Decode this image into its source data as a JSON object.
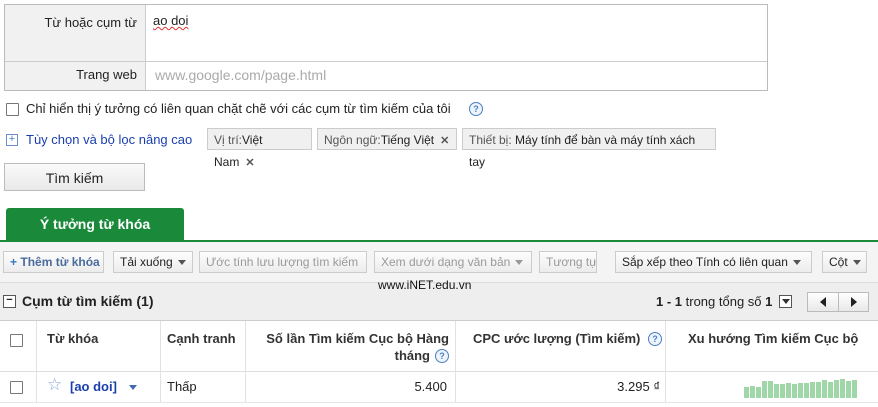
{
  "form": {
    "keyword_label": "Từ hoặc cụm từ",
    "keyword_value": "ao doi",
    "website_label": "Trang web",
    "website_placeholder": "www.google.com/page.html"
  },
  "options": {
    "close_match_label": "Chỉ hiển thị ý tưởng có liên quan chặt chẽ với các cụm từ tìm kiếm của tôi",
    "advanced_label": "Tùy chọn và bộ lọc nâng cao",
    "filters": [
      {
        "prefix": "Vị trí:",
        "value": "Việt Nam"
      },
      {
        "prefix": "Ngôn ngữ:",
        "value": "Tiếng Việt"
      },
      {
        "prefix": "Thiết bị: ",
        "value": "Máy tính để bàn và máy tính xách tay"
      }
    ]
  },
  "search_button": "Tìm kiếm",
  "tab": {
    "label": "Ý tưởng từ khóa"
  },
  "toolbar": {
    "add_keyword": "Thêm từ khóa",
    "download": "Tải xuống",
    "estimate_traffic": "Ước tính lưu lượng tìm kiếm",
    "view_as_text": "Xem dưới dạng văn bản",
    "similar": "Tương tự",
    "sort": "Sắp xếp theo Tính có liên quan",
    "columns": "Cột"
  },
  "watermark": "www.iNET.edu.vn",
  "group": {
    "title": "Cụm từ tìm kiếm (1)",
    "range": "1 - 1",
    "of_label": "trong tổng số",
    "total": "1"
  },
  "table": {
    "headers": {
      "keyword": "Từ khóa",
      "competition": "Cạnh tranh",
      "local_searches_line1": "Số lần Tìm kiếm Cục bộ Hàng",
      "local_searches_line2": "tháng",
      "cpc": "CPC ước lượng (Tìm kiếm)",
      "trend": "Xu hướng Tìm kiếm Cục bộ"
    },
    "rows": [
      {
        "keyword": "[ao doi]",
        "competition": "Thấp",
        "local_searches": "5.400",
        "cpc": "3.295 ₫",
        "trend": [
          0.55,
          0.6,
          0.55,
          0.85,
          0.85,
          0.7,
          0.7,
          0.75,
          0.7,
          0.75,
          0.75,
          0.8,
          0.8,
          0.9,
          0.8,
          0.9,
          0.95,
          0.85,
          0.9
        ]
      }
    ]
  },
  "colors": {
    "tab_green": "#1a8a3a",
    "link_blue": "#1a3fad",
    "trend_green": "#9fd7a8"
  }
}
